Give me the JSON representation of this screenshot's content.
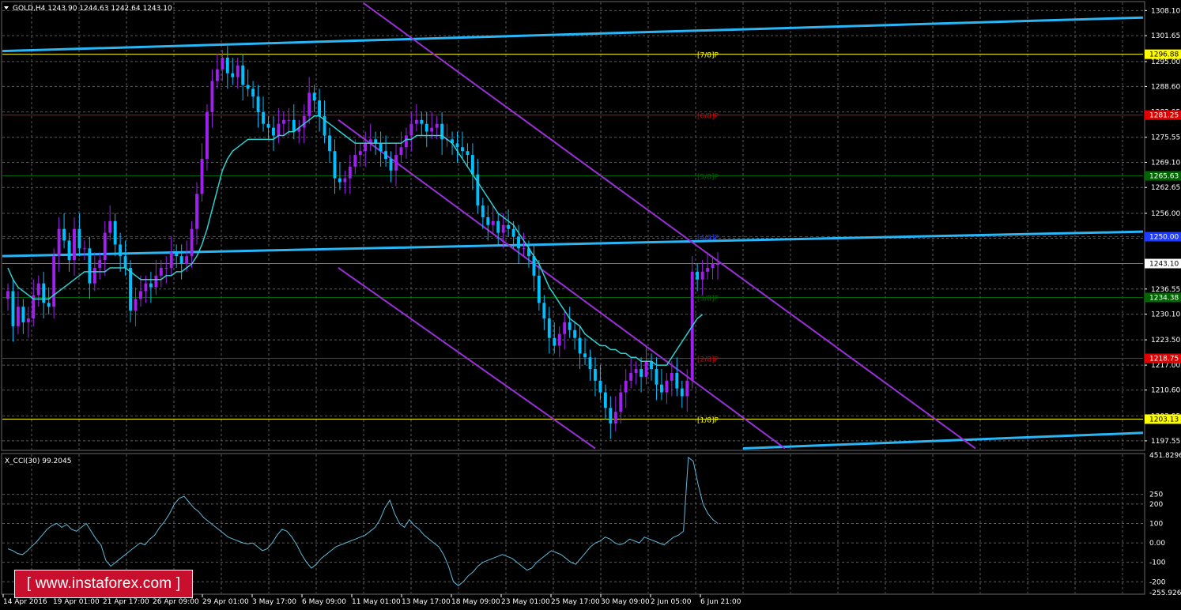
{
  "header": {
    "main_title": "GOLD,H4  1243.90 1244.63 1242.64 1243.10",
    "cci_title": "X_CCI(30) 99.2045"
  },
  "logo": {
    "text": "[ www.instaforex.com ]"
  },
  "colors": {
    "background": "#000000",
    "grid": "#5a5a5a",
    "bull": "#a020f0",
    "bear": "#00bfff",
    "ma": "#2fd0d0",
    "trend": "#29b6f6",
    "channel": "#9b30d9",
    "murray_yellow": "#ffff00",
    "murray_red": "#e00000",
    "murray_green": "#006400",
    "blue_dash": "#1e3cff",
    "cci": "#5fb8d8"
  },
  "chart_data": [
    {
      "type": "candlestick",
      "symbol": "GOLD",
      "timeframe": "H4",
      "ylim": [
        1195.5,
        1310
      ],
      "y_ticks": [
        "1308.10",
        "1301.65",
        "1295.00",
        "1288.60",
        "1282.05",
        "1275.55",
        "1269.10",
        "1262.65",
        "1256.00",
        "1249.60",
        "1243.10",
        "1236.55",
        "1230.10",
        "1223.50",
        "1217.00",
        "1210.60",
        "1203.95",
        "1197.55"
      ],
      "x_labels": [
        "14 Apr 2016",
        "19 Apr 01:00",
        "21 Apr 17:00",
        "26 Apr 09:00",
        "29 Apr 01:00",
        "3 May 17:00",
        "6 May 09:00",
        "11 May 01:00",
        "13 May 17:00",
        "18 May 09:00",
        "23 May 01:00",
        "25 May 17:00",
        "30 May 09:00",
        "2 Jun 05:00",
        "6 Jun 21:00"
      ],
      "current_price": "1243.10",
      "ohlc_last": {
        "open": 1243.9,
        "high": 1244.63,
        "low": 1242.64,
        "close": 1243.1
      },
      "closes": [
        1236,
        1227,
        1232,
        1228,
        1229,
        1235,
        1238,
        1233,
        1232,
        1245,
        1252,
        1249,
        1244,
        1252,
        1247,
        1247,
        1238,
        1242,
        1244,
        1251,
        1254,
        1248,
        1245,
        1242,
        1231,
        1234,
        1236,
        1238,
        1237,
        1240,
        1242,
        1242,
        1246,
        1245,
        1243,
        1245,
        1252,
        1261,
        1270,
        1282,
        1290,
        1293,
        1296,
        1292,
        1291,
        1294,
        1289,
        1288,
        1286,
        1282,
        1279,
        1278,
        1276,
        1279,
        1280,
        1280,
        1277,
        1278,
        1281,
        1287,
        1285,
        1281,
        1276,
        1272,
        1265,
        1264,
        1265,
        1268,
        1271,
        1272,
        1274,
        1275,
        1274,
        1272,
        1270,
        1267,
        1271,
        1273,
        1276,
        1279,
        1280,
        1279,
        1277,
        1278,
        1279,
        1275,
        1275,
        1274,
        1273,
        1272,
        1271,
        1266,
        1258,
        1255,
        1253,
        1254,
        1251,
        1253,
        1252,
        1250,
        1247,
        1247,
        1245,
        1240,
        1233,
        1229,
        1224,
        1222,
        1225,
        1228,
        1226,
        1224,
        1220,
        1219,
        1216,
        1213,
        1210,
        1206,
        1202,
        1205,
        1210,
        1213,
        1215,
        1216,
        1214,
        1218,
        1216,
        1212,
        1210,
        1213,
        1215,
        1211,
        1209,
        1213,
        1241,
        1239,
        1241,
        1242,
        1243,
        1243
      ],
      "murray_levels": [
        {
          "label": "[7/8]P",
          "value": "1296.88",
          "color": "yellow"
        },
        {
          "label": "[6/8]P",
          "value": "1281.25",
          "color": "red"
        },
        {
          "label": "[5/8]P",
          "value": "1265.63",
          "color": "green"
        },
        {
          "label": "[4/8]P",
          "value": "1250.00",
          "color": "blue"
        },
        {
          "label": "[3/8]P",
          "value": "1234.38",
          "color": "green"
        },
        {
          "label": "[2/8]P",
          "value": "1218.75",
          "color": "red"
        },
        {
          "label": "[1/8]P",
          "value": "1203.13",
          "color": "yellow"
        }
      ],
      "moving_average": [
        1242,
        1239,
        1237,
        1236,
        1235,
        1234,
        1234,
        1234,
        1234,
        1235,
        1236,
        1237,
        1238,
        1239,
        1240,
        1241,
        1241,
        1241,
        1241,
        1241,
        1242,
        1242,
        1242,
        1242,
        1241,
        1240,
        1239,
        1239,
        1239,
        1239,
        1239,
        1240,
        1240,
        1241,
        1241,
        1242,
        1243,
        1245,
        1248,
        1252,
        1257,
        1262,
        1267,
        1270,
        1272,
        1273,
        1274,
        1275,
        1275,
        1275,
        1275,
        1275,
        1275,
        1276,
        1276,
        1277,
        1277,
        1278,
        1279,
        1280,
        1281,
        1281,
        1280,
        1279,
        1278,
        1277,
        1276,
        1275,
        1274,
        1274,
        1274,
        1274,
        1274,
        1274,
        1274,
        1274,
        1274,
        1274,
        1275,
        1275,
        1276,
        1276,
        1276,
        1276,
        1276,
        1276,
        1275,
        1274,
        1272,
        1270,
        1268,
        1266,
        1264,
        1262,
        1260,
        1258,
        1256,
        1255,
        1254,
        1253,
        1251,
        1249,
        1247,
        1245,
        1243,
        1240,
        1237,
        1235,
        1233,
        1231,
        1229,
        1228,
        1227,
        1225,
        1224,
        1223,
        1222,
        1222,
        1221,
        1221,
        1220,
        1220,
        1219,
        1219,
        1218,
        1218,
        1218,
        1217,
        1217,
        1217,
        1219,
        1221,
        1223,
        1225,
        1227,
        1229,
        1230
      ]
    },
    {
      "type": "line",
      "name": "X_CCI(30)",
      "ylim": [
        -255.9265,
        451.8296
      ],
      "y_ticks": [
        "451.8296",
        "250",
        "200",
        "100",
        "0.00",
        "-100",
        "-200",
        "-255.9265"
      ],
      "values": [
        -30,
        -40,
        -55,
        -60,
        -40,
        -15,
        10,
        40,
        70,
        90,
        100,
        80,
        95,
        70,
        60,
        80,
        100,
        60,
        20,
        -10,
        -90,
        -120,
        -100,
        -80,
        -60,
        -40,
        -20,
        0,
        -10,
        20,
        40,
        80,
        110,
        150,
        200,
        230,
        240,
        210,
        180,
        160,
        130,
        110,
        90,
        70,
        50,
        30,
        20,
        10,
        0,
        -5,
        0,
        -20,
        -40,
        -30,
        0,
        40,
        70,
        60,
        30,
        -10,
        -60,
        -100,
        -130,
        -110,
        -80,
        -60,
        -40,
        -20,
        -10,
        0,
        10,
        20,
        30,
        40,
        60,
        80,
        120,
        180,
        220,
        150,
        100,
        80,
        120,
        90,
        70,
        40,
        20,
        0,
        -20,
        -60,
        -120,
        -200,
        -220,
        -200,
        -170,
        -150,
        -120,
        -100,
        -90,
        -80,
        -70,
        -60,
        -70,
        -80,
        -100,
        -120,
        -140,
        -130,
        -100,
        -80,
        -60,
        -40,
        -50,
        -60,
        -80,
        -100,
        -110,
        -80,
        -50,
        -20,
        0,
        10,
        30,
        20,
        0,
        -10,
        0,
        20,
        10,
        0,
        30,
        20,
        10,
        0,
        -10,
        10,
        30,
        40,
        60,
        440,
        420,
        300,
        200,
        150,
        120,
        100
      ]
    }
  ]
}
